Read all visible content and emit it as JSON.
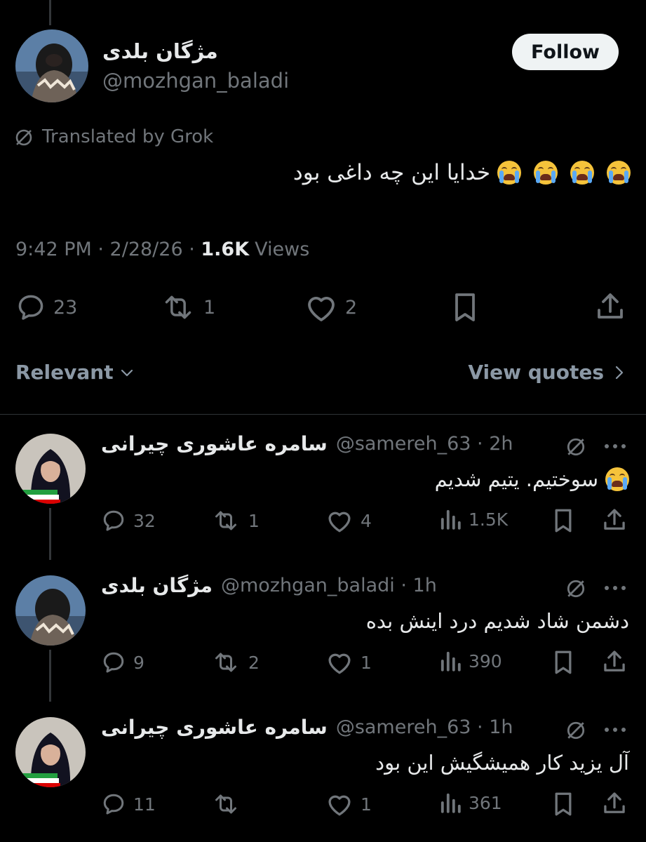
{
  "main_tweet": {
    "display_name": "مژگان بلدی",
    "handle": "@mozhgan_baladi",
    "follow_label": "Follow",
    "translated_label": "Translated by Grok",
    "text": "خدایا این چه داغی بود",
    "emoji_count": 4,
    "time": "9:42 PM",
    "date": "2/28/26",
    "views_count": "1.6K",
    "views_label": "Views",
    "reply_count": "23",
    "retweet_count": "1",
    "like_count": "2"
  },
  "sort": {
    "relevant_label": "Relevant",
    "view_quotes_label": "View quotes"
  },
  "replies": [
    {
      "display_name": "سامره عاشوری چیرانی",
      "handle": "@samereh_63",
      "age": "2h",
      "text": "سوختیم. یتیم شدیم",
      "has_emoji": true,
      "reply_count": "32",
      "retweet_count": "1",
      "like_count": "4",
      "views": "1.5K"
    },
    {
      "display_name": "مژگان بلدی",
      "handle": "@mozhgan_baladi",
      "age": "1h",
      "text": "دشمن شاد شدیم درد اینش بده",
      "has_emoji": false,
      "reply_count": "9",
      "retweet_count": "2",
      "like_count": "1",
      "views": "390"
    },
    {
      "display_name": "سامره عاشوری چیرانی",
      "handle": "@samereh_63",
      "age": "1h",
      "text": "آل یزید کار همیشگیش این بود",
      "has_emoji": false,
      "reply_count": "11",
      "retweet_count": "",
      "like_count": "1",
      "views": "361"
    }
  ],
  "colors": {
    "background": "#000000",
    "text_primary": "#e7e9ea",
    "text_secondary": "#71767b",
    "divider": "#2f3336"
  }
}
